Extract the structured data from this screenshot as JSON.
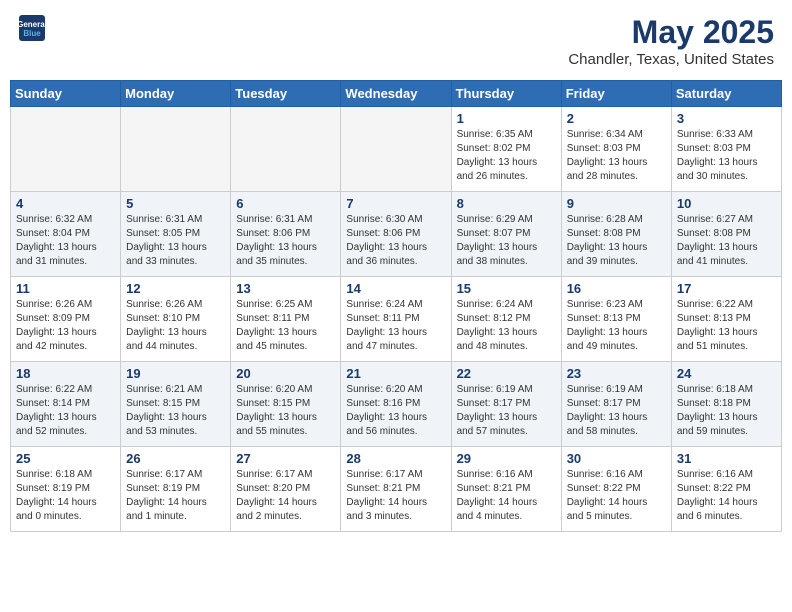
{
  "header": {
    "logo_line1": "General",
    "logo_line2": "Blue",
    "title": "May 2025",
    "subtitle": "Chandler, Texas, United States"
  },
  "calendar": {
    "days_of_week": [
      "Sunday",
      "Monday",
      "Tuesday",
      "Wednesday",
      "Thursday",
      "Friday",
      "Saturday"
    ],
    "weeks": [
      [
        {
          "num": "",
          "info": ""
        },
        {
          "num": "",
          "info": ""
        },
        {
          "num": "",
          "info": ""
        },
        {
          "num": "",
          "info": ""
        },
        {
          "num": "1",
          "info": "Sunrise: 6:35 AM\nSunset: 8:02 PM\nDaylight: 13 hours\nand 26 minutes."
        },
        {
          "num": "2",
          "info": "Sunrise: 6:34 AM\nSunset: 8:03 PM\nDaylight: 13 hours\nand 28 minutes."
        },
        {
          "num": "3",
          "info": "Sunrise: 6:33 AM\nSunset: 8:03 PM\nDaylight: 13 hours\nand 30 minutes."
        }
      ],
      [
        {
          "num": "4",
          "info": "Sunrise: 6:32 AM\nSunset: 8:04 PM\nDaylight: 13 hours\nand 31 minutes."
        },
        {
          "num": "5",
          "info": "Sunrise: 6:31 AM\nSunset: 8:05 PM\nDaylight: 13 hours\nand 33 minutes."
        },
        {
          "num": "6",
          "info": "Sunrise: 6:31 AM\nSunset: 8:06 PM\nDaylight: 13 hours\nand 35 minutes."
        },
        {
          "num": "7",
          "info": "Sunrise: 6:30 AM\nSunset: 8:06 PM\nDaylight: 13 hours\nand 36 minutes."
        },
        {
          "num": "8",
          "info": "Sunrise: 6:29 AM\nSunset: 8:07 PM\nDaylight: 13 hours\nand 38 minutes."
        },
        {
          "num": "9",
          "info": "Sunrise: 6:28 AM\nSunset: 8:08 PM\nDaylight: 13 hours\nand 39 minutes."
        },
        {
          "num": "10",
          "info": "Sunrise: 6:27 AM\nSunset: 8:08 PM\nDaylight: 13 hours\nand 41 minutes."
        }
      ],
      [
        {
          "num": "11",
          "info": "Sunrise: 6:26 AM\nSunset: 8:09 PM\nDaylight: 13 hours\nand 42 minutes."
        },
        {
          "num": "12",
          "info": "Sunrise: 6:26 AM\nSunset: 8:10 PM\nDaylight: 13 hours\nand 44 minutes."
        },
        {
          "num": "13",
          "info": "Sunrise: 6:25 AM\nSunset: 8:11 PM\nDaylight: 13 hours\nand 45 minutes."
        },
        {
          "num": "14",
          "info": "Sunrise: 6:24 AM\nSunset: 8:11 PM\nDaylight: 13 hours\nand 47 minutes."
        },
        {
          "num": "15",
          "info": "Sunrise: 6:24 AM\nSunset: 8:12 PM\nDaylight: 13 hours\nand 48 minutes."
        },
        {
          "num": "16",
          "info": "Sunrise: 6:23 AM\nSunset: 8:13 PM\nDaylight: 13 hours\nand 49 minutes."
        },
        {
          "num": "17",
          "info": "Sunrise: 6:22 AM\nSunset: 8:13 PM\nDaylight: 13 hours\nand 51 minutes."
        }
      ],
      [
        {
          "num": "18",
          "info": "Sunrise: 6:22 AM\nSunset: 8:14 PM\nDaylight: 13 hours\nand 52 minutes."
        },
        {
          "num": "19",
          "info": "Sunrise: 6:21 AM\nSunset: 8:15 PM\nDaylight: 13 hours\nand 53 minutes."
        },
        {
          "num": "20",
          "info": "Sunrise: 6:20 AM\nSunset: 8:15 PM\nDaylight: 13 hours\nand 55 minutes."
        },
        {
          "num": "21",
          "info": "Sunrise: 6:20 AM\nSunset: 8:16 PM\nDaylight: 13 hours\nand 56 minutes."
        },
        {
          "num": "22",
          "info": "Sunrise: 6:19 AM\nSunset: 8:17 PM\nDaylight: 13 hours\nand 57 minutes."
        },
        {
          "num": "23",
          "info": "Sunrise: 6:19 AM\nSunset: 8:17 PM\nDaylight: 13 hours\nand 58 minutes."
        },
        {
          "num": "24",
          "info": "Sunrise: 6:18 AM\nSunset: 8:18 PM\nDaylight: 13 hours\nand 59 minutes."
        }
      ],
      [
        {
          "num": "25",
          "info": "Sunrise: 6:18 AM\nSunset: 8:19 PM\nDaylight: 14 hours\nand 0 minutes."
        },
        {
          "num": "26",
          "info": "Sunrise: 6:17 AM\nSunset: 8:19 PM\nDaylight: 14 hours\nand 1 minute."
        },
        {
          "num": "27",
          "info": "Sunrise: 6:17 AM\nSunset: 8:20 PM\nDaylight: 14 hours\nand 2 minutes."
        },
        {
          "num": "28",
          "info": "Sunrise: 6:17 AM\nSunset: 8:21 PM\nDaylight: 14 hours\nand 3 minutes."
        },
        {
          "num": "29",
          "info": "Sunrise: 6:16 AM\nSunset: 8:21 PM\nDaylight: 14 hours\nand 4 minutes."
        },
        {
          "num": "30",
          "info": "Sunrise: 6:16 AM\nSunset: 8:22 PM\nDaylight: 14 hours\nand 5 minutes."
        },
        {
          "num": "31",
          "info": "Sunrise: 6:16 AM\nSunset: 8:22 PM\nDaylight: 14 hours\nand 6 minutes."
        }
      ]
    ]
  }
}
